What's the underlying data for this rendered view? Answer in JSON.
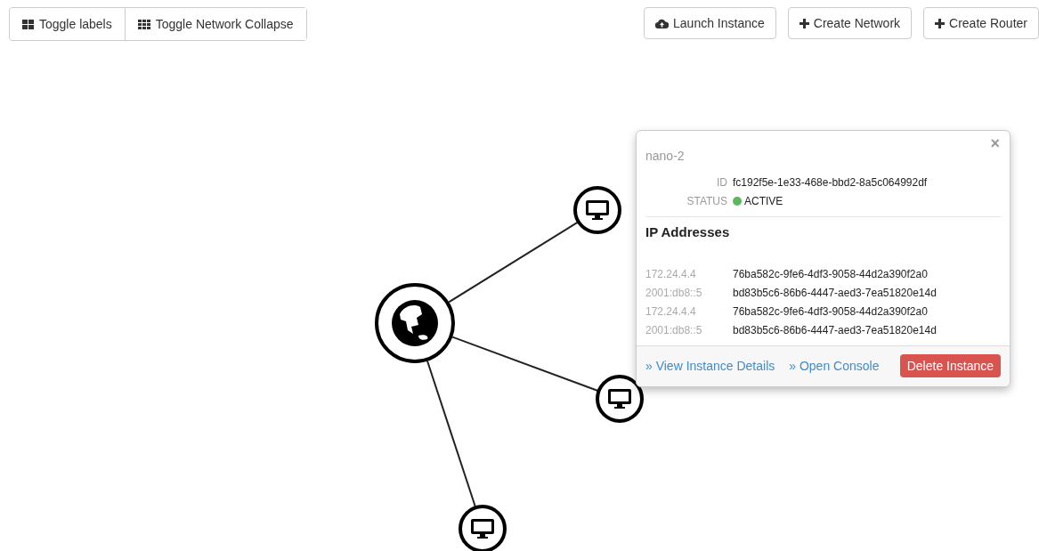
{
  "toolbar_left": [
    {
      "label": "Toggle labels"
    },
    {
      "label": "Toggle Network Collapse"
    }
  ],
  "toolbar_right": [
    {
      "label": "Launch Instance"
    },
    {
      "label": "Create Network"
    },
    {
      "label": "Create Router"
    }
  ],
  "topology": {
    "nodes": [
      {
        "kind": "network"
      },
      {
        "kind": "instance"
      },
      {
        "kind": "instance"
      },
      {
        "kind": "instance"
      }
    ]
  },
  "popover": {
    "title": "nano-2",
    "close": "×",
    "fields": [
      {
        "label": "ID",
        "value": "fc192f5e-1e33-468e-bbd2-8a5c064992df"
      },
      {
        "label": "STATUS",
        "value": "ACTIVE",
        "color": "#5cb85c"
      }
    ],
    "section_title": "IP Addresses",
    "ip_addresses": [
      {
        "ip": "172.24.4.4",
        "port": "76ba582c-9fe6-4df3-9058-44d2a390f2a0"
      },
      {
        "ip": "2001:db8::5",
        "port": "bd83b5c6-86b6-4447-aed3-7ea51820e14d"
      },
      {
        "ip": "172.24.4.4",
        "port": "76ba582c-9fe6-4df3-9058-44d2a390f2a0"
      },
      {
        "ip": "2001:db8::5",
        "port": "bd83b5c6-86b6-4447-aed3-7ea51820e14d"
      }
    ],
    "links": [
      "» View Instance Details",
      "» Open Console"
    ],
    "delete_button": "Delete Instance"
  }
}
